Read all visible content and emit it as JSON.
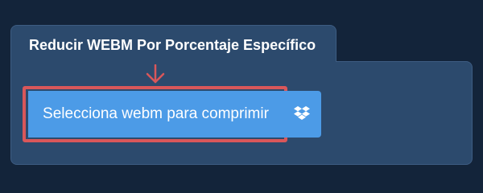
{
  "panel": {
    "title": "Reducir WEBM Por Porcentaje Específico"
  },
  "upload": {
    "select_label": "Selecciona webm para comprimir",
    "dropbox_icon": "dropbox-icon"
  },
  "colors": {
    "background": "#13243a",
    "panel": "#2c4a6d",
    "button": "#4c9be7",
    "highlight": "#d9575a"
  }
}
